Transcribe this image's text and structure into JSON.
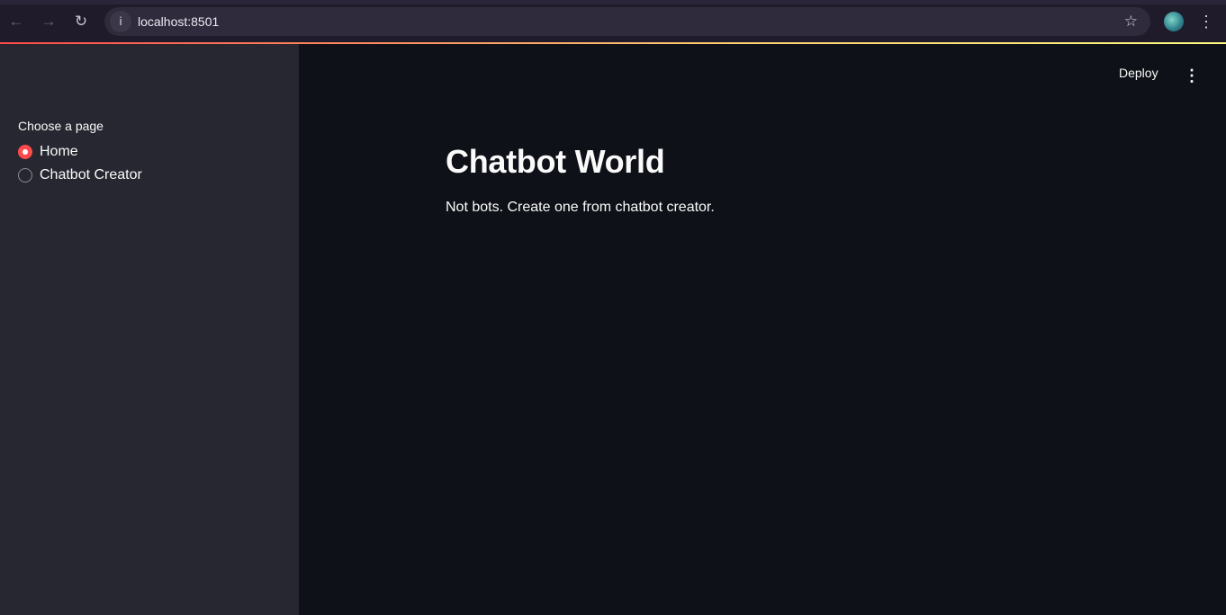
{
  "browser": {
    "url": "localhost:8501",
    "icons": {
      "back": "arrow-left-icon",
      "forward": "arrow-right-icon",
      "reload": "reload-icon",
      "site_info": "info-icon",
      "bookmark": "star-icon",
      "profile": "profile-avatar",
      "menu": "kebab-menu-icon"
    }
  },
  "sidebar": {
    "radio_label": "Choose a page",
    "options": [
      {
        "label": "Home",
        "selected": true
      },
      {
        "label": "Chatbot Creator",
        "selected": false
      }
    ]
  },
  "toolbar": {
    "deploy_label": "Deploy"
  },
  "main": {
    "title": "Chatbot World",
    "message": "Not bots. Create one from chatbot creator."
  },
  "colors": {
    "accent": "#ff4b4b",
    "sidebar_bg": "#262730",
    "main_bg": "#0e1117",
    "text": "#fafafa"
  }
}
